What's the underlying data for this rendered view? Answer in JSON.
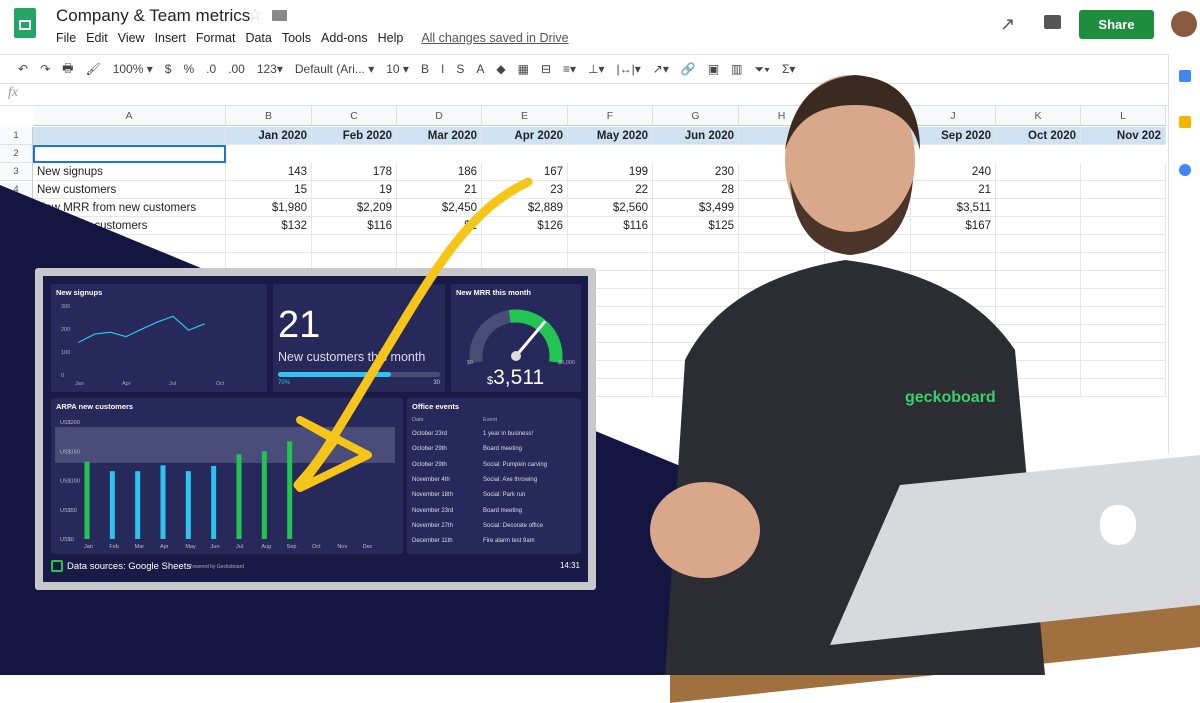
{
  "app": {
    "title": "Company & Team metrics",
    "menu": [
      "File",
      "Edit",
      "View",
      "Insert",
      "Format",
      "Data",
      "Tools",
      "Add-ons",
      "Help"
    ],
    "saved_status": "All changes saved in Drive",
    "share_label": "Share"
  },
  "toolbar": {
    "items": [
      "↶",
      "↷",
      "🖶",
      "🖌",
      "100% ▾",
      "$",
      "%",
      ".0",
      ".00",
      "123▾",
      "Default (Ari... ▾",
      "10 ▾",
      "B",
      "I",
      "S",
      "A",
      "◆",
      "▦",
      "⊟",
      "≡▾",
      "⊥▾",
      "|↔|▾",
      "↗▾",
      "🔗",
      "▣",
      "▥",
      "⏷▾",
      "Σ▾"
    ],
    "fx": "fx"
  },
  "sheet": {
    "columns": [
      "A",
      "B",
      "C",
      "D",
      "E",
      "F",
      "G",
      "H",
      "I",
      "J",
      "K",
      "L"
    ],
    "rows": [
      "1",
      "2",
      "3",
      "4",
      "5",
      "6",
      "7",
      "8",
      "9",
      "10",
      "11",
      "12",
      "13",
      "14",
      "15"
    ],
    "header_row": [
      "",
      "Jan 2020",
      "Feb 2020",
      "Mar 2020",
      "Apr 2020",
      "May 2020",
      "Jun 2020",
      "",
      "",
      "Sep 2020",
      "Oct 2020",
      "Nov 202"
    ],
    "data": [
      {
        "label": "New signups",
        "values": [
          "143",
          "178",
          "186",
          "167",
          "199",
          "230",
          "",
          "",
          "240",
          "",
          ""
        ]
      },
      {
        "label": "New customers",
        "values": [
          "15",
          "19",
          "21",
          "23",
          "22",
          "28",
          "",
          "",
          "21",
          "",
          ""
        ]
      },
      {
        "label": "New MRR from new customers",
        "values": [
          "$1,980",
          "$2,209",
          "$2,450",
          "$2,889",
          "$2,560",
          "$3,499",
          "",
          "",
          "$3,511",
          "",
          ""
        ]
      },
      {
        "label": "ARPA new customers",
        "values": [
          "$132",
          "$116",
          "$1",
          "$126",
          "$116",
          "$125",
          "",
          "",
          "$167",
          "",
          ""
        ]
      }
    ]
  },
  "dashboard": {
    "signups": {
      "title": "New signups",
      "yticks": [
        "300",
        "200",
        "100",
        "0"
      ],
      "xticks": [
        "Jan",
        "Apr",
        "Jul",
        "Oct"
      ]
    },
    "customers": {
      "value": "21",
      "label": "New customers this month",
      "progress_pct": 70,
      "progress_label": "70%",
      "goal": "30"
    },
    "mrr": {
      "title": "New MRR this month",
      "min": "$0",
      "max": "$5,000",
      "currency": "$",
      "value": "3,511",
      "fraction": 0.702
    },
    "arpa": {
      "title": "ARPA new customers",
      "yticks": [
        "US$200",
        "US$150",
        "US$100",
        "US$50",
        "US$0"
      ]
    },
    "events": {
      "title": "Office events",
      "col_date": "Date",
      "col_event": "Event",
      "rows": [
        [
          "October 23rd",
          "1 year in business!"
        ],
        [
          "October 29th",
          "Board meeting"
        ],
        [
          "October 29th",
          "Social: Pumpkin carving"
        ],
        [
          "November 4th",
          "Social: Axe throwing"
        ],
        [
          "November 18th",
          "Social: Park run"
        ],
        [
          "November 23rd",
          "Board meeting"
        ],
        [
          "November 27th",
          "Social: Decorate office"
        ],
        [
          "December 11th",
          "Fire alarm test 9am"
        ]
      ]
    },
    "footer": {
      "source": "Data sources: Google Sheets",
      "powered": "Powered by Geckoboard",
      "time": "14:31"
    }
  },
  "shirt_logo": "geckoboard",
  "colors": {
    "green": "#23c552",
    "blue": "#2ec4f0",
    "navy": "#151542",
    "arrow": "#f5c518",
    "share": "#1e8e3e"
  },
  "chart_data": [
    {
      "type": "line",
      "title": "New signups",
      "categories": [
        "Jan",
        "Feb",
        "Mar",
        "Apr",
        "May",
        "Jun",
        "Jul",
        "Aug",
        "Sep"
      ],
      "values": [
        143,
        178,
        186,
        167,
        199,
        230,
        255,
        195,
        222
      ],
      "ylim": [
        0,
        300
      ],
      "xticks": [
        "Jan",
        "Apr",
        "Jul",
        "Oct"
      ]
    },
    {
      "type": "bar",
      "title": "ARPA new customers",
      "categories": [
        "Jan",
        "Feb",
        "Mar",
        "Apr",
        "May",
        "Jun",
        "Jul",
        "Aug",
        "Sep",
        "Oct",
        "Nov",
        "Dec"
      ],
      "values": [
        132,
        116,
        116,
        126,
        116,
        125,
        145,
        150,
        167,
        null,
        null,
        null
      ],
      "bar_colors": [
        "green",
        "blue",
        "blue",
        "blue",
        "blue",
        "blue",
        "green",
        "green",
        "green"
      ],
      "target_band": [
        130,
        200
      ],
      "ylim": [
        0,
        200
      ]
    }
  ]
}
